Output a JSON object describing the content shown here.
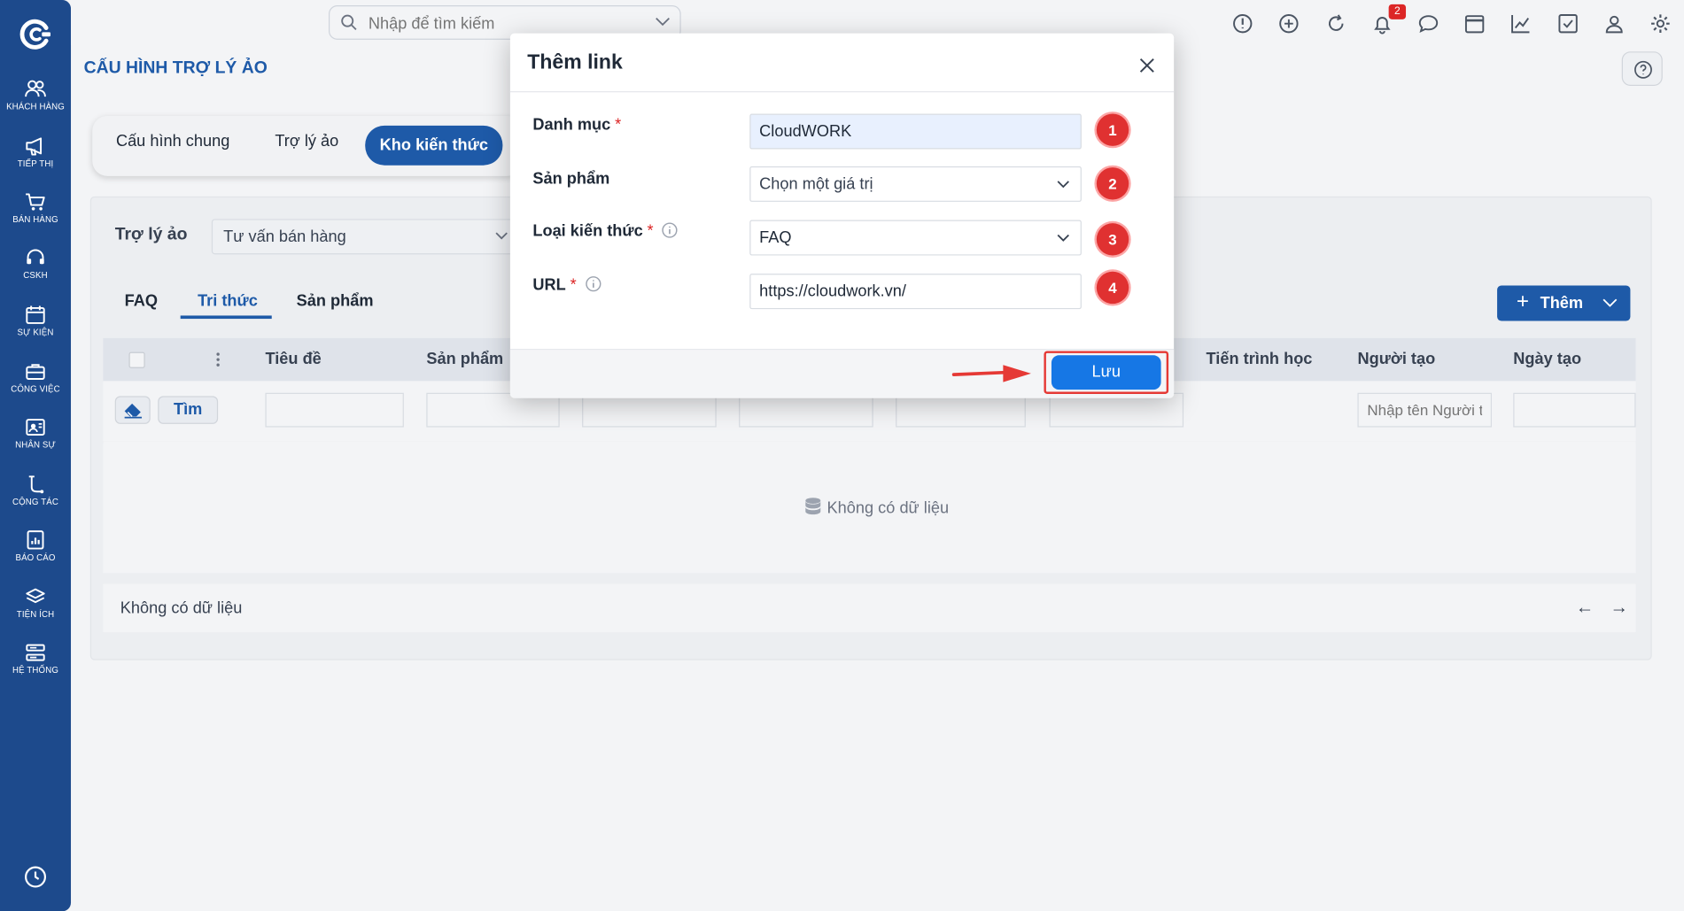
{
  "sidebar": {
    "items": [
      {
        "label": "KHÁCH HÀNG",
        "icon": "customers-icon"
      },
      {
        "label": "TIẾP THỊ",
        "icon": "megaphone-icon"
      },
      {
        "label": "BÁN HÀNG",
        "icon": "cart-icon"
      },
      {
        "label": "CSKH",
        "icon": "headset-icon"
      },
      {
        "label": "SỰ KIỆN",
        "icon": "calendar-icon"
      },
      {
        "label": "CÔNG VIỆC",
        "icon": "briefcase-icon"
      },
      {
        "label": "NHÂN SỰ",
        "icon": "id-card-icon"
      },
      {
        "label": "CỘNG TÁC",
        "icon": "flow-icon"
      },
      {
        "label": "BÁO CÁO",
        "icon": "report-icon"
      },
      {
        "label": "TIỆN ÍCH",
        "icon": "layers-icon"
      },
      {
        "label": "HỆ THỐNG",
        "icon": "server-icon"
      }
    ]
  },
  "topbar": {
    "search_placeholder": "Nhập để tìm kiếm",
    "notification_count": "2"
  },
  "page": {
    "title": "CẤU HÌNH TRỢ LÝ ẢO",
    "tabs": [
      "Cấu hình chung",
      "Trợ lý ảo",
      "Kho kiến thức"
    ],
    "active_tab": "Kho kiến thức"
  },
  "assistant": {
    "label": "Trợ lý ảo",
    "value": "Tư vấn bán hàng"
  },
  "subtabs": [
    "FAQ",
    "Tri thức",
    "Sản phẩm"
  ],
  "add_button": "Thêm",
  "table": {
    "columns": [
      "Tiêu đề",
      "Sản phẩm",
      "Tiến trình học",
      "Người tạo",
      "Ngày tạo"
    ],
    "find_button": "Tìm",
    "creator_filter_placeholder": "Nhập tên Người tạo",
    "empty_text": "Không có dữ liệu",
    "footer_text": "Không có dữ liệu"
  },
  "modal": {
    "title": "Thêm link",
    "fields": [
      {
        "label": "Danh mục",
        "required": true,
        "value": "CloudWORK",
        "step": "1"
      },
      {
        "label": "Sản phẩm",
        "required": false,
        "value": "Chọn một giá trị",
        "step": "2"
      },
      {
        "label": "Loại kiến thức",
        "required": true,
        "value": "FAQ",
        "step": "3"
      },
      {
        "label": "URL",
        "required": true,
        "value": "https://cloudwork.vn/",
        "step": "4"
      }
    ],
    "required_mark": "*",
    "save_label": "Lưu"
  },
  "colors": {
    "sidebar": "#1d4a8c",
    "primary": "#1e5aa8",
    "save_button": "#1677e5",
    "highlight": "#e53935"
  }
}
